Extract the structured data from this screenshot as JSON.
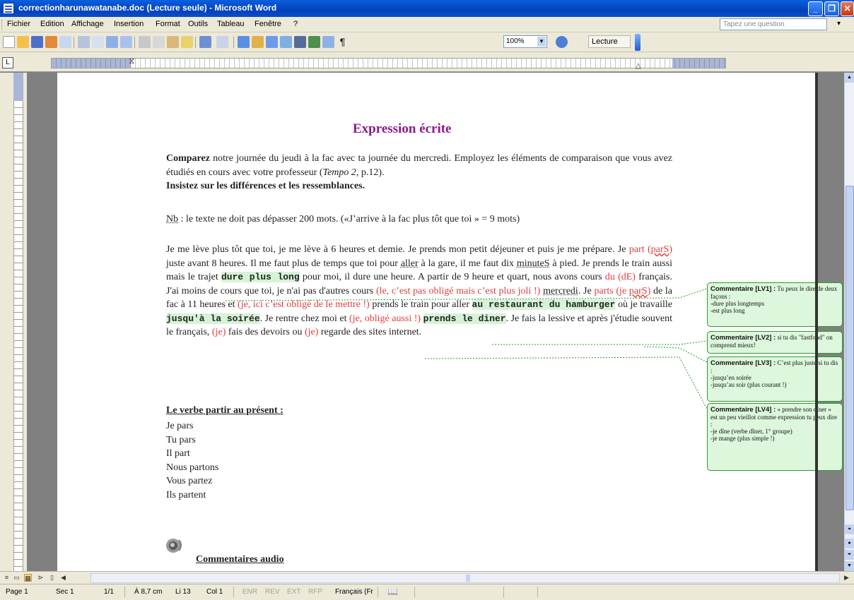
{
  "window": {
    "title": "correctionharunawatanabe.doc (Lecture seule) - Microsoft Word"
  },
  "menu": [
    "Fichier",
    "Edition",
    "Affichage",
    "Insertion",
    "Format",
    "Outils",
    "Tableau",
    "Fenêtre",
    "?"
  ],
  "help_placeholder": "Tapez une question",
  "toolbar": {
    "zoom": "100%",
    "lecture_label": "Lecture"
  },
  "document": {
    "title": "Expression écrite",
    "intro": {
      "p1_bold": "Comparez",
      "p1": " notre journée du jeudi à la fac avec ta journée du mercredi. Employez les éléments de comparaison que vous avez étudiés en cours avec votre professeur (",
      "book": "Tempo 2",
      "p1_end": ", p.12).",
      "p2_bold": "Insistez sur les différences et les ressemblances."
    },
    "nb": {
      "label": "Nb",
      "text": " : le texte ne doit pas dépasser 200 mots. («J’arrive à la fac plus tôt que toi » = 9 mots)"
    },
    "main": {
      "s1": "Je me lève plus tôt que toi, je me lève à 6 heures et demie.  Je prends mon petit déjeuner et puis je me prépare.  Je ",
      "part": "part",
      "parS_open": " (",
      "parS": "parS",
      "parS_close": ")",
      "s2": "  juste avant 8 heures.  Il me faut plus de temps que toi pour ",
      "aller": "aller",
      "s3": " à la gare, il me faut dix ",
      "minuteS": "minuteS",
      "s4": " à pied.  Je prends le train aussi mais le trajet ",
      "hl1": "dure plus long",
      "s5": " pour moi,  il dure une heure.  A partir de 9 heure et quart, nous avons cours ",
      "du_dE": "du (dE)",
      "s6": " français. J'ai moins de cours que toi, je n'ai pas d'autres cours ",
      "red1": "(le, c’est pas obligé mais c’est plus joli !)",
      "s7": "  ",
      "mercredi": "mercredi",
      "s8": ". Je ",
      "parts": "parts (je ",
      "parS2": "parS",
      "parts_close": ")",
      "s9": " de la fac à 11 heures et ",
      "red2": "(je, ici c’est obligé de le mettre !)",
      "s10": " prends le train pour aller ",
      "hl2": "au restaurant du hamburger",
      "s11": " où je travaille ",
      "hl3": "jusqu'à la soirée",
      "s12": ".  Je rentre chez moi et ",
      "red3": "(je, obligé aussi !)",
      "s13": " ",
      "hl4": "prends le diner",
      "s14": ".  Je fais la lessive et après j'étudie souvent le français, ",
      "je1": "(je)",
      "s15": " fais des devoirs ou ",
      "je2": "(je)",
      "s16": " regarde des sites internet."
    },
    "verb_heading": "Le verbe partir au présent :",
    "verb_forms": [
      "Je pars",
      "Tu pars",
      "Il part",
      "Nous partons",
      "Vous partez",
      "Ils partent"
    ],
    "audio_heading": "Commentaires audio"
  },
  "comments": [
    {
      "head": "Commentaire [LV1] :",
      "lines": [
        " Tu peux le dire de deux façons :",
        "-dure plus longtemps",
        "-est plus long"
      ]
    },
    {
      "head": "Commentaire [LV2] :",
      "lines": [
        " si tu dis \"fastfood\" on comprend mieux!"
      ]
    },
    {
      "head": "Commentaire [LV3] :",
      "lines": [
        " C’est plus juste si tu dis :",
        "-jusqu’en soirée",
        "-jusqu’au soir (plus courant !)"
      ]
    },
    {
      "head": "Commentaire [LV4] :",
      "lines": [
        " « prendre son dîner » est un peu vieillot comme expression tu peux dire :",
        "-je dîne (verbe dîner, 1° groupe)",
        "-je mange (plus simple !)"
      ]
    }
  ],
  "statusbar": {
    "page": "Page 1",
    "section": "Sec 1",
    "pages": "1/1",
    "position": "À 8,7 cm",
    "line": "Li 13",
    "column": "Col 1",
    "modes": [
      "ENR",
      "REV",
      "EXT",
      "RFP"
    ],
    "language": "Français (Fr"
  },
  "colors": {
    "title_purple": "#8b1a8b",
    "correction_red": "#e23c3c",
    "balloon_green": "#dcf7dc"
  }
}
